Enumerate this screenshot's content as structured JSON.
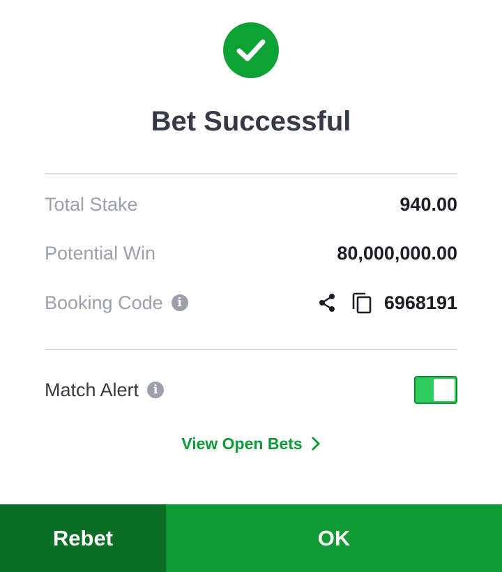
{
  "header": {
    "status_icon": "check-icon",
    "title": "Bet Successful"
  },
  "summary": {
    "total_stake_label": "Total Stake",
    "total_stake_value": "940.00",
    "potential_win_label": "Potential Win",
    "potential_win_value": "80,000,000.00",
    "booking_code_label": "Booking Code",
    "booking_code_value": "6968191",
    "info_icon_glyph": "i"
  },
  "match_alert": {
    "label": "Match Alert",
    "info_icon_glyph": "i",
    "enabled": true
  },
  "links": {
    "view_open_bets": "View Open Bets"
  },
  "footer": {
    "rebet_label": "Rebet",
    "ok_label": "OK"
  },
  "colors": {
    "accent_green": "#0f9a35",
    "dark_green": "#0b6e27",
    "toggle_green": "#2fcb5d",
    "label_gray": "#9ca0ab",
    "title_dark": "#353a45"
  }
}
